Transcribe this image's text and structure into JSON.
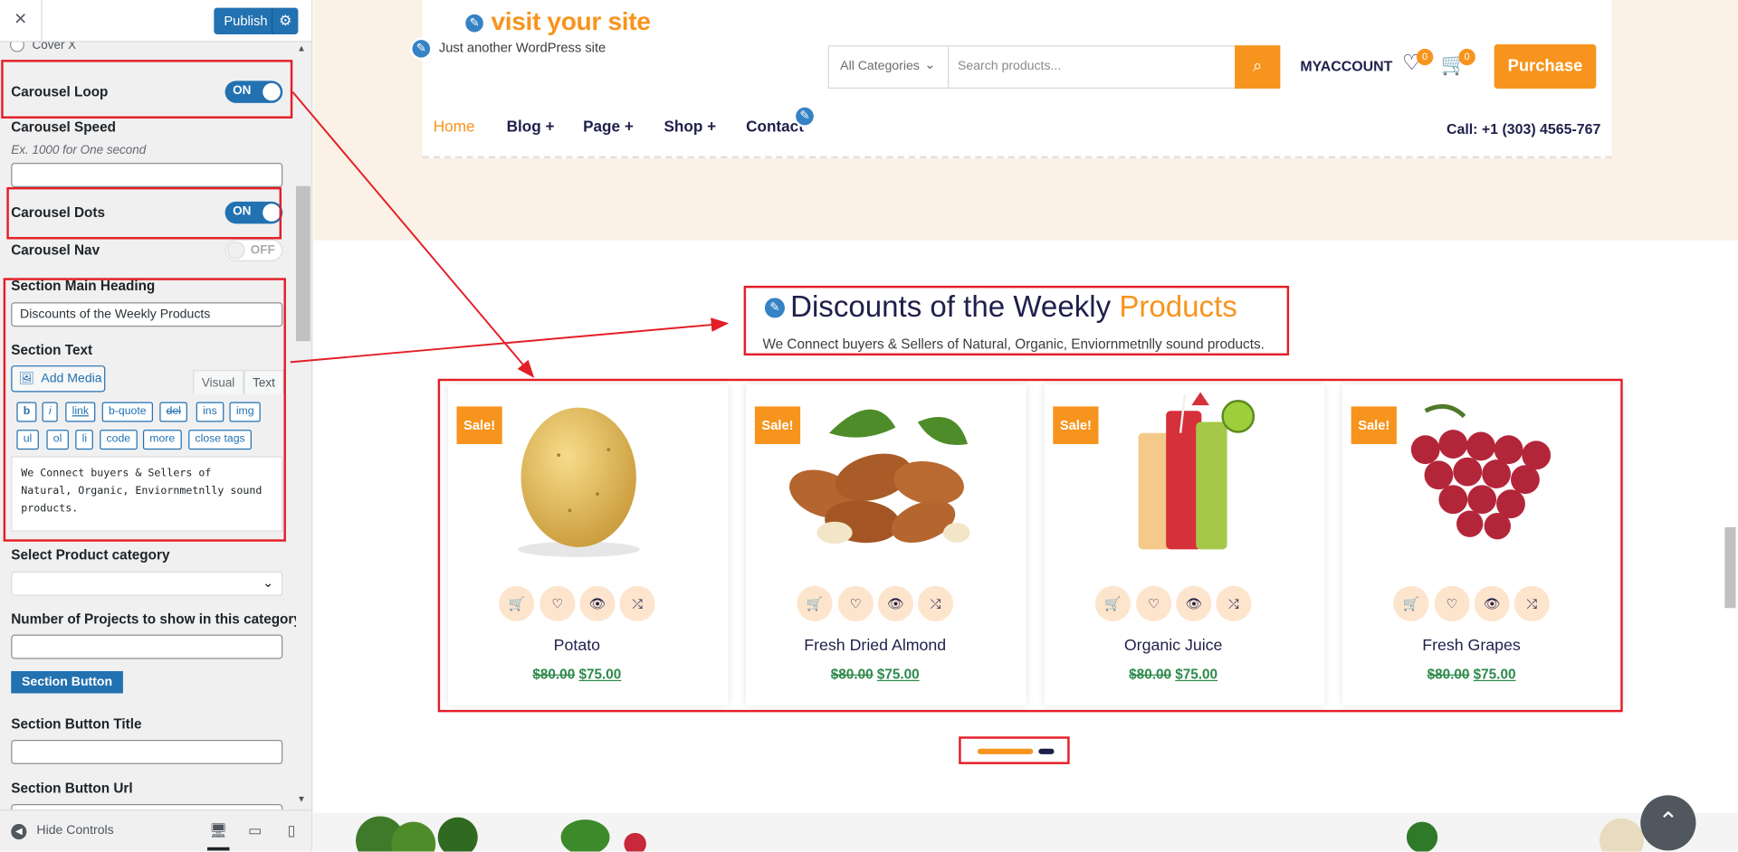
{
  "sidebar": {
    "close_icon": "×",
    "publish_label": "Publish",
    "gear_icon": "⚙",
    "cover_label": "Cover X",
    "loop": {
      "label": "Carousel Loop",
      "state": "ON"
    },
    "speed": {
      "label": "Carousel Speed",
      "hint": "Ex. 1000 for One second",
      "value": ""
    },
    "dots": {
      "label": "Carousel Dots",
      "state": "ON"
    },
    "nav": {
      "label": "Carousel Nav",
      "state": "OFF"
    },
    "heading": {
      "label": "Section Main Heading",
      "value": "Discounts of the Weekly Products"
    },
    "text": {
      "label": "Section Text",
      "add_media": "Add Media",
      "tab_visual": "Visual",
      "tab_text": "Text",
      "quicktags_row1": [
        "b",
        "i",
        "link",
        "b-quote",
        "del",
        "ins",
        "img"
      ],
      "quicktags_row2": [
        "ul",
        "ol",
        "li",
        "code",
        "more",
        "close tags"
      ],
      "value_lines": [
        "We Connect buyers & Sellers of",
        "Natural, Organic, Enviornmetnlly sound",
        "products."
      ]
    },
    "category": {
      "label": "Select Product category",
      "value": ""
    },
    "projects": {
      "label": "Number of Projects to show in this category",
      "value": ""
    },
    "section_button": "Section Button",
    "button_title": {
      "label": "Section Button Title",
      "value": ""
    },
    "button_url": {
      "label": "Section Button Url"
    },
    "hide_controls": "Hide Controls"
  },
  "site": {
    "title": "visit your site",
    "tagline": "Just another WordPress site",
    "search": {
      "category": "All Categories",
      "placeholder": "Search products..."
    },
    "my_account": "MYACCOUNT",
    "wishlist_count": "0",
    "cart_count": "0",
    "purchase": "Purchase",
    "nav": [
      {
        "label": "Home"
      },
      {
        "label": "Blog",
        "plus": "+"
      },
      {
        "label": "Page",
        "plus": "+"
      },
      {
        "label": "Shop",
        "plus": "+"
      },
      {
        "label": "Contact"
      }
    ],
    "phone": "Call: +1 (303) 4565-767"
  },
  "section": {
    "heading_main": "Discounts of the Weekly",
    "heading_accent": "Products",
    "text": "We Connect buyers & Sellers of Natural, Organic, Enviornmetnlly sound products."
  },
  "products": [
    {
      "name": "Potato",
      "badge": "Sale!",
      "old_price": "$80.00",
      "new_price": "$75.00"
    },
    {
      "name": "Fresh Dried Almond",
      "badge": "Sale!",
      "old_price": "$80.00",
      "new_price": "$75.00"
    },
    {
      "name": "Organic Juice",
      "badge": "Sale!",
      "old_price": "$80.00",
      "new_price": "$75.00"
    },
    {
      "name": "Fresh Grapes",
      "badge": "Sale!",
      "old_price": "$80.00",
      "new_price": "$75.00"
    }
  ],
  "colors": {
    "accent": "#f7941d",
    "navy": "#1f1f4c",
    "wp_blue": "#2271b1",
    "annotation_red": "#e41e26"
  },
  "icons": {
    "cart": "cart-icon",
    "heart": "heart-icon",
    "eye": "eye-icon",
    "compare": "shuffle-icon",
    "search": "search-icon",
    "scroll_top": "chevron-up-icon"
  }
}
